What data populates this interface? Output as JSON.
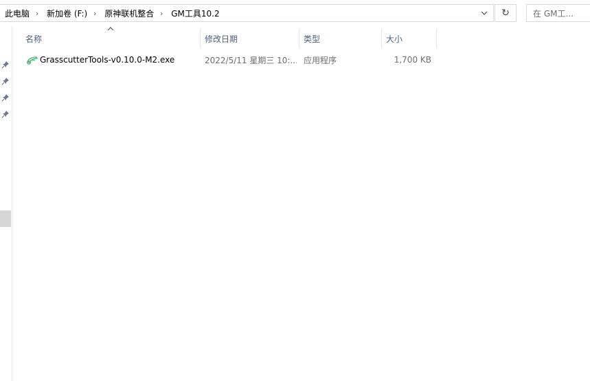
{
  "breadcrumb": {
    "items": [
      {
        "label": "此电脑"
      },
      {
        "label": "新加卷 (F:)"
      },
      {
        "label": "原神联机整合"
      },
      {
        "label": "GM工具10.2"
      }
    ]
  },
  "search": {
    "placeholder": "在 GM工..."
  },
  "columns": {
    "name": "名称",
    "date": "修改日期",
    "type": "类型",
    "size": "大小"
  },
  "files": [
    {
      "name": "GrasscutterTools-v0.10.0-M2.exe",
      "date": "2022/5/11 星期三 10:...",
      "type": "应用程序",
      "size": "1,700 KB",
      "icon": "grasscutter-app-icon"
    }
  ],
  "colors": {
    "header_text": "#4c607a",
    "meta_text": "#6d6d6d",
    "border": "#d9d9d9",
    "icon_green": "#3fae6a"
  }
}
